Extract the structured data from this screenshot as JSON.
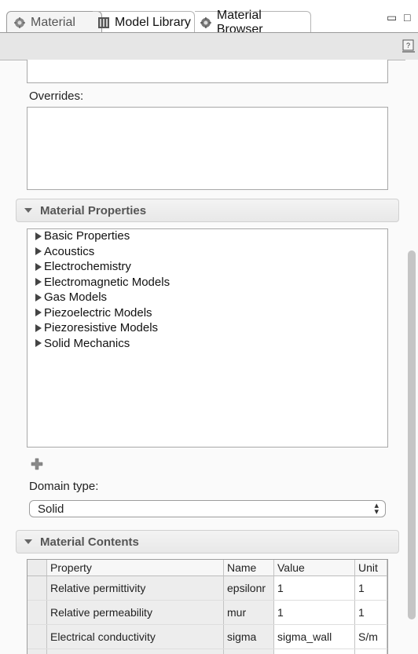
{
  "tabs": [
    {
      "label": "Material",
      "icon": "material-icon",
      "active": true
    },
    {
      "label": "Model Library",
      "icon": "model-library-icon",
      "active": false
    },
    {
      "label": "Material Browser",
      "icon": "material-browser-icon",
      "active": false
    }
  ],
  "window_controls": {
    "minimize": "▭",
    "maximize": "□"
  },
  "overrides": {
    "label": "Overrides:"
  },
  "material_properties": {
    "title": "Material Properties",
    "items": [
      "Basic Properties",
      "Acoustics",
      "Electrochemistry",
      "Electromagnetic Models",
      "Gas Models",
      "Piezoelectric Models",
      "Piezoresistive Models",
      "Solid Mechanics"
    ]
  },
  "domain_type": {
    "label": "Domain type:",
    "value": "Solid"
  },
  "material_contents": {
    "title": "Material Contents",
    "columns": [
      "Property",
      "Name",
      "Value",
      "Unit"
    ],
    "rows": [
      [
        "Relative permittivity",
        "epsilonr",
        "1",
        "1"
      ],
      [
        "Relative permeability",
        "mur",
        "1",
        "1"
      ],
      [
        "Electrical conductivity",
        "sigma",
        "sigma_wall",
        "S/m"
      ]
    ]
  },
  "colors": {
    "accent_header": "#555555",
    "panel_bg": "#fafafa",
    "toolbar_bg": "#e6e6e6"
  }
}
